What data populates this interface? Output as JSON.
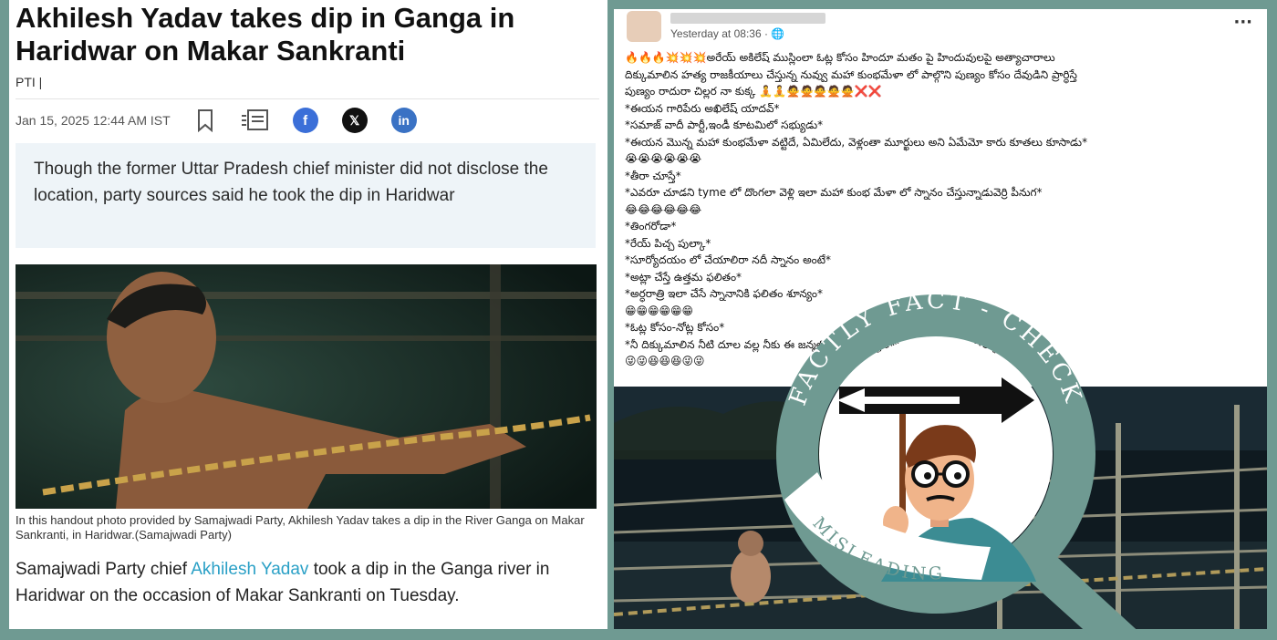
{
  "article": {
    "headline": "Akhilesh Yadav takes dip in Ganga in Haridwar on Makar Sankranti",
    "byline": "PTI |",
    "date": "Jan 15, 2025 12:44 AM IST",
    "summary": "Though the former Uttar Pradesh chief minister did not disclose the location, party sources said he took the dip in Haridwar",
    "caption": "In this handout photo provided by Samajwadi Party, Akhilesh Yadav takes a dip in the River Ganga on Makar Sankranti, in Haridwar.(Samajwadi Party)",
    "body_before_link": "Samajwadi Party chief ",
    "body_link": "Akhilesh Yadav",
    "body_after_link": " took a dip in the Ganga river in Haridwar on the occasion of Makar Sankranti on Tuesday.",
    "share_icons": [
      "bookmark-icon",
      "copy-icon",
      "facebook-icon",
      "x-icon",
      "linkedin-icon"
    ],
    "colors": {
      "facebook": "#3b6fd8",
      "x": "#111111",
      "linkedin": "#3a72c4",
      "link": "#2aa0c6"
    }
  },
  "post": {
    "time": "Yesterday at 08:36 · ",
    "more": "···",
    "lines": [
      "🔥🔥🔥💥💥💥అరేయ్ అకిలేష్ ముస్లింలా ఓట్ల కోసం హిందూ మతం పై హిందువులపై అత్యాచారాలు",
      "దిక్కుమాలిన హత్య రాజకీయాలు చేస్తున్న నువ్వు మహా కుంభమేళా లో పాల్గొని పుణ్యం కోసం దేవుడిని ప్రార్ధిస్తే",
      "పుణ్యం రాదురా చిల్లర నా కుక్క 🧘🧘🙅🙅🙅🙅🙅❌❌",
      " *ఈయన గారిపేరు అఖిలేష్ యాదవ్*",
      " *సమాజ్ వాదీ పార్టీ,ఇండీ కూటమిలో సభ్యుడు*",
      " *ఈయన మొన్న మహా కుంభమేళా వట్టిదే, ఏమిలేదు, వెళ్లంతా మూర్ఖులు అని ఏమేమో కారు కూతలు కూసాడు*",
      "          😭😭😭😭😭😭",
      "               *తీరా చూస్తే*",
      " *ఎవరూ చూడని tyme లో దొంగలా వెళ్లి ఇలా మహా కుంభ మేళా లో స్నానం చేస్తున్నాడువెర్రి పీనుగ*",
      "          😂😂😂😂😂😂",
      "               *తింగరోడా*",
      "            *రేయ్ పిచ్చ పుల్కా*",
      " *సూర్యోదయం లో చేయాలిరా నదీ స్నానం అంటే*",
      "   *అట్లా చేస్తే ఉత్తమ ఫలితం*",
      " *అర్ధరాత్రి ఇలా చేసే స్నానానికి ఫలితం శూన్యం*",
      "          😁😁😁😁😁😁",
      "           *ఓట్ల కోసం-నోట్ల కోసం*",
      " *నీ దిక్కుమాలిన నీటి దూల వల్ల నీకు ఈ జన్మలో దొరికే పుణ్య ఫలం కల్పోయావురా మూర్ఖుడా*",
      "          😜😜😆😆😆😜😜"
    ]
  },
  "badge": {
    "ring_text": "FACTLY FACT - CHECK",
    "label": "MISLEADING",
    "colors": {
      "ring": "#6f9a92",
      "ring_text": "#ffffff",
      "banner": "#ffffff",
      "banner_text": "#6f9a92"
    }
  }
}
